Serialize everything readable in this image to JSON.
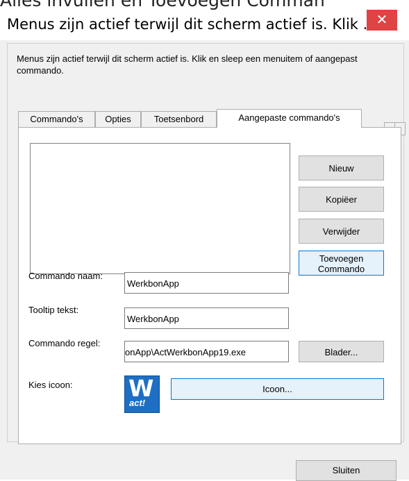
{
  "banner": "Alles invullen en Toevoegen Comman",
  "window": {
    "title": "Menus zijn actief terwijl dit scherm actief is. Klik ...",
    "close_glyph": "✕",
    "accent_close": "#e04343"
  },
  "description": "Menus zijn actief terwijl dit scherm actief is. Klik en sleep een menuitem of aangepast commando.",
  "tabs": [
    {
      "label": "Commando's"
    },
    {
      "label": "Opties"
    },
    {
      "label": "Toetsenbord"
    },
    {
      "label": "Aangepaste commando's",
      "active": true
    }
  ],
  "tab_scroll": {
    "left": "◂",
    "right": "▸"
  },
  "buttons": {
    "new": "Nieuw",
    "copy": "Kopiëer",
    "delete": "Verwijder",
    "add_command": "Toevoegen Commando",
    "browse": "Blader...",
    "icon": "Icoon...",
    "close": "Sluiten"
  },
  "form": {
    "command_name_label": "Commando naam:",
    "command_name_value": "WerkbonApp",
    "tooltip_label": "Tooltip tekst:",
    "tooltip_value": "WerkbonApp",
    "command_line_label": "Commando regel:",
    "command_line_value": "onApp\\ActWerkbonApp19.exe",
    "icon_label": "Kies icoon:"
  },
  "app_icon": {
    "name": "act-werkbon-app-icon",
    "letter": "W",
    "text": "act!",
    "color": "#1e6fc3"
  }
}
